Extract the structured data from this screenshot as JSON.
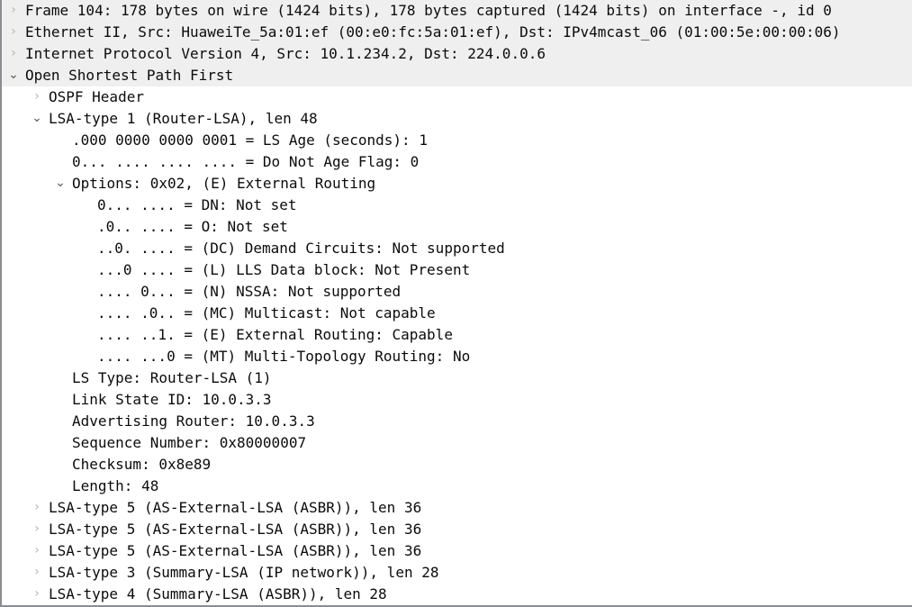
{
  "pane": {
    "name": "packet-details",
    "app": "Wireshark",
    "selected_background": "#efefef",
    "text_color": "#0b0b0b",
    "chevron_collapsed_color": "#b6b6b6",
    "chevron_expanded_color": "#58595b",
    "chevron_collapsed_glyph": "›",
    "chevron_expanded_glyph": "⌄"
  },
  "rows": [
    {
      "id": "frame",
      "depth": 0,
      "chevron": "collapsed",
      "selected": true,
      "text": "Frame 104: 178 bytes on wire (1424 bits), 178 bytes captured (1424 bits) on interface -, id 0"
    },
    {
      "id": "ethernet-ii",
      "depth": 0,
      "chevron": "collapsed",
      "selected": true,
      "text": "Ethernet II, Src: HuaweiTe_5a:01:ef (00:e0:fc:5a:01:ef), Dst: IPv4mcast_06 (01:00:5e:00:00:06)"
    },
    {
      "id": "ipv4",
      "depth": 0,
      "chevron": "collapsed",
      "selected": true,
      "text": "Internet Protocol Version 4, Src: 10.1.234.2, Dst: 224.0.0.6"
    },
    {
      "id": "ospf",
      "depth": 0,
      "chevron": "expanded",
      "selected": true,
      "text": "Open Shortest Path First"
    },
    {
      "id": "ospf-header",
      "depth": 1,
      "chevron": "collapsed",
      "selected": false,
      "text": "OSPF Header"
    },
    {
      "id": "lsa-type-1",
      "depth": 1,
      "chevron": "expanded",
      "selected": false,
      "text": "LSA-type 1 (Router-LSA), len 48"
    },
    {
      "id": "ls-age",
      "depth": 2,
      "chevron": "none",
      "selected": false,
      "text": ".000 0000 0000 0001 = LS Age (seconds): 1"
    },
    {
      "id": "do-not-age-flag",
      "depth": 2,
      "chevron": "none",
      "selected": false,
      "text": "0... .... .... .... = Do Not Age Flag: 0"
    },
    {
      "id": "options",
      "depth": 2,
      "chevron": "expanded",
      "selected": false,
      "text": "Options: 0x02, (E) External Routing"
    },
    {
      "id": "option-dn",
      "depth": 3,
      "chevron": "none",
      "selected": false,
      "text": "0... .... = DN: Not set"
    },
    {
      "id": "option-o",
      "depth": 3,
      "chevron": "none",
      "selected": false,
      "text": ".0.. .... = O: Not set"
    },
    {
      "id": "option-dc",
      "depth": 3,
      "chevron": "none",
      "selected": false,
      "text": "..0. .... = (DC) Demand Circuits: Not supported"
    },
    {
      "id": "option-l",
      "depth": 3,
      "chevron": "none",
      "selected": false,
      "text": "...0 .... = (L) LLS Data block: Not Present"
    },
    {
      "id": "option-n",
      "depth": 3,
      "chevron": "none",
      "selected": false,
      "text": ".... 0... = (N) NSSA: Not supported"
    },
    {
      "id": "option-mc",
      "depth": 3,
      "chevron": "none",
      "selected": false,
      "text": ".... .0.. = (MC) Multicast: Not capable"
    },
    {
      "id": "option-e",
      "depth": 3,
      "chevron": "none",
      "selected": false,
      "text": ".... ..1. = (E) External Routing: Capable"
    },
    {
      "id": "option-mt",
      "depth": 3,
      "chevron": "none",
      "selected": false,
      "text": ".... ...0 = (MT) Multi-Topology Routing: No"
    },
    {
      "id": "ls-type",
      "depth": 2,
      "chevron": "none",
      "selected": false,
      "text": "LS Type: Router-LSA (1)"
    },
    {
      "id": "link-state-id",
      "depth": 2,
      "chevron": "none",
      "selected": false,
      "text": "Link State ID: 10.0.3.3"
    },
    {
      "id": "advertising-router",
      "depth": 2,
      "chevron": "none",
      "selected": false,
      "text": "Advertising Router: 10.0.3.3"
    },
    {
      "id": "sequence-number",
      "depth": 2,
      "chevron": "none",
      "selected": false,
      "text": "Sequence Number: 0x80000007"
    },
    {
      "id": "checksum",
      "depth": 2,
      "chevron": "none",
      "selected": false,
      "text": "Checksum: 0x8e89"
    },
    {
      "id": "length",
      "depth": 2,
      "chevron": "none",
      "selected": false,
      "text": "Length: 48"
    },
    {
      "id": "lsa-type-5-a",
      "depth": 1,
      "chevron": "collapsed",
      "selected": false,
      "text": "LSA-type 5 (AS-External-LSA (ASBR)), len 36"
    },
    {
      "id": "lsa-type-5-b",
      "depth": 1,
      "chevron": "collapsed",
      "selected": false,
      "text": "LSA-type 5 (AS-External-LSA (ASBR)), len 36"
    },
    {
      "id": "lsa-type-5-c",
      "depth": 1,
      "chevron": "collapsed",
      "selected": false,
      "text": "LSA-type 5 (AS-External-LSA (ASBR)), len 36"
    },
    {
      "id": "lsa-type-3",
      "depth": 1,
      "chevron": "collapsed",
      "selected": false,
      "text": "LSA-type 3 (Summary-LSA (IP network)), len 28"
    },
    {
      "id": "lsa-type-4",
      "depth": 1,
      "chevron": "collapsed",
      "selected": false,
      "text": "LSA-type 4 (Summary-LSA (ASBR)), len 28"
    }
  ]
}
